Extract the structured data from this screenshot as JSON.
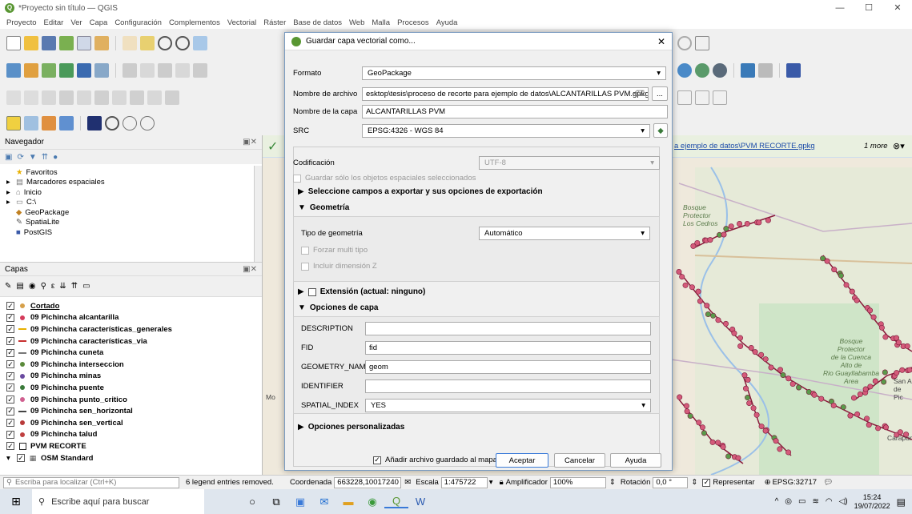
{
  "window": {
    "title": "*Proyecto sin título — QGIS"
  },
  "menu": [
    "Proyecto",
    "Editar",
    "Ver",
    "Capa",
    "Configuración",
    "Complementos",
    "Vectorial",
    "Ráster",
    "Base de datos",
    "Web",
    "Malla",
    "Procesos",
    "Ayuda"
  ],
  "browser": {
    "title": "Navegador",
    "items": [
      "Favoritos",
      "Marcadores espaciales",
      "Inicio",
      "C:\\",
      "GeoPackage",
      "SpatiaLite",
      "PostGIS"
    ]
  },
  "layers_panel": {
    "title": "Capas",
    "layers": [
      {
        "name": "Cortado",
        "sym": "dot",
        "color": "#d6a04a",
        "underline": true
      },
      {
        "name": "09 Pichincha alcantarilla",
        "sym": "dot",
        "color": "#d43b5b"
      },
      {
        "name": "09 Pichincha características_generales",
        "sym": "line",
        "color": "#e8b000"
      },
      {
        "name": "09 Pichincha características_via",
        "sym": "line",
        "color": "#c83030"
      },
      {
        "name": "09 Pichincha cuneta",
        "sym": "line",
        "color": "#777777"
      },
      {
        "name": "09 Pichincha interseccion",
        "sym": "dot",
        "color": "#5a8a3a"
      },
      {
        "name": "09 Pichincha minas",
        "sym": "dot",
        "color": "#6a4aa0"
      },
      {
        "name": "09 Pichincha puente",
        "sym": "dot",
        "color": "#3a7a3a"
      },
      {
        "name": "09 Pichincha punto_critico",
        "sym": "dot",
        "color": "#d06090"
      },
      {
        "name": "09 Pichincha sen_horizontal",
        "sym": "line",
        "color": "#444444"
      },
      {
        "name": "09 Pichincha sen_vertical",
        "sym": "dot",
        "color": "#b83a3a"
      },
      {
        "name": "09 Pichincha talud",
        "sym": "dot",
        "color": "#c04040"
      },
      {
        "name": "PVM RECORTE",
        "sym": "box",
        "color": "#ffffff"
      },
      {
        "name": "OSM Standard",
        "sym": "osm",
        "color": "#555555"
      }
    ]
  },
  "message_bar": {
    "link": "a ejemplo de datos\\PVM RECORTE.gpkg",
    "more": "1 more"
  },
  "map_labels": [
    "Bosque",
    "Protector",
    "Los Cedros",
    "Bosque",
    "Protector",
    "de la Cuenca",
    "Alto de",
    "Rio Guayllabamba",
    "Area",
    "San A",
    "de Pic",
    "Carapun",
    "Mo"
  ],
  "dialog": {
    "title": "Guardar capa vectorial como...",
    "format_label": "Formato",
    "format_value": "GeoPackage",
    "filename_label": "Nombre de archivo",
    "filename_value": "esktop\\tesis\\proceso de recorte para ejemplo de datos\\ALCANTARILLAS PVM.gpkg",
    "browse_label": "...",
    "layername_label": "Nombre de la capa",
    "layername_value": "ALCANTARILLAS PVM",
    "crs_label": "SRC",
    "crs_value": "EPSG:4326 - WGS 84",
    "encoding_label": "Codificación",
    "encoding_value": "UTF-8",
    "only_selected": "Guardar sólo los objetos espaciales seleccionados",
    "select_fields": "Seleccione campos a exportar y sus opciones de exportación",
    "geometry_section": "Geometría",
    "geom_type_label": "Tipo de geometría",
    "geom_type_value": "Automático",
    "force_multi": "Forzar multi tipo",
    "include_z": "Incluir dimensión Z",
    "extent": "Extensión (actual: ninguno)",
    "layer_options": "Opciones de capa",
    "options": [
      {
        "key": "DESCRIPTION",
        "value": "",
        "type": "text"
      },
      {
        "key": "FID",
        "value": "fid",
        "type": "text"
      },
      {
        "key": "GEOMETRY_NAME",
        "value": "geom",
        "type": "text"
      },
      {
        "key": "IDENTIFIER",
        "value": "",
        "type": "text"
      },
      {
        "key": "SPATIAL_INDEX",
        "value": "YES",
        "type": "combo"
      }
    ],
    "custom_options": "Opciones personalizadas",
    "add_to_map": "Añadir archivo guardado al mapa",
    "accept": "Aceptar",
    "cancel": "Cancelar",
    "help": "Ayuda"
  },
  "statusbar": {
    "search_placeholder": "Escriba para localizar (Ctrl+K)",
    "legend_msg": "6 legend entries removed.",
    "coord_label": "Coordenada",
    "coord_value": "663228,10017240",
    "scale_label": "Escala",
    "scale_value": "1:475722",
    "magnifier_label": "Amplificador",
    "magnifier_value": "100%",
    "rotation_label": "Rotación",
    "rotation_value": "0,0 °",
    "render_label": "Representar",
    "crs": "EPSG:32717"
  },
  "taskbar": {
    "search_placeholder": "Escribe aquí para buscar",
    "time": "15:24",
    "date": "19/07/2022"
  }
}
